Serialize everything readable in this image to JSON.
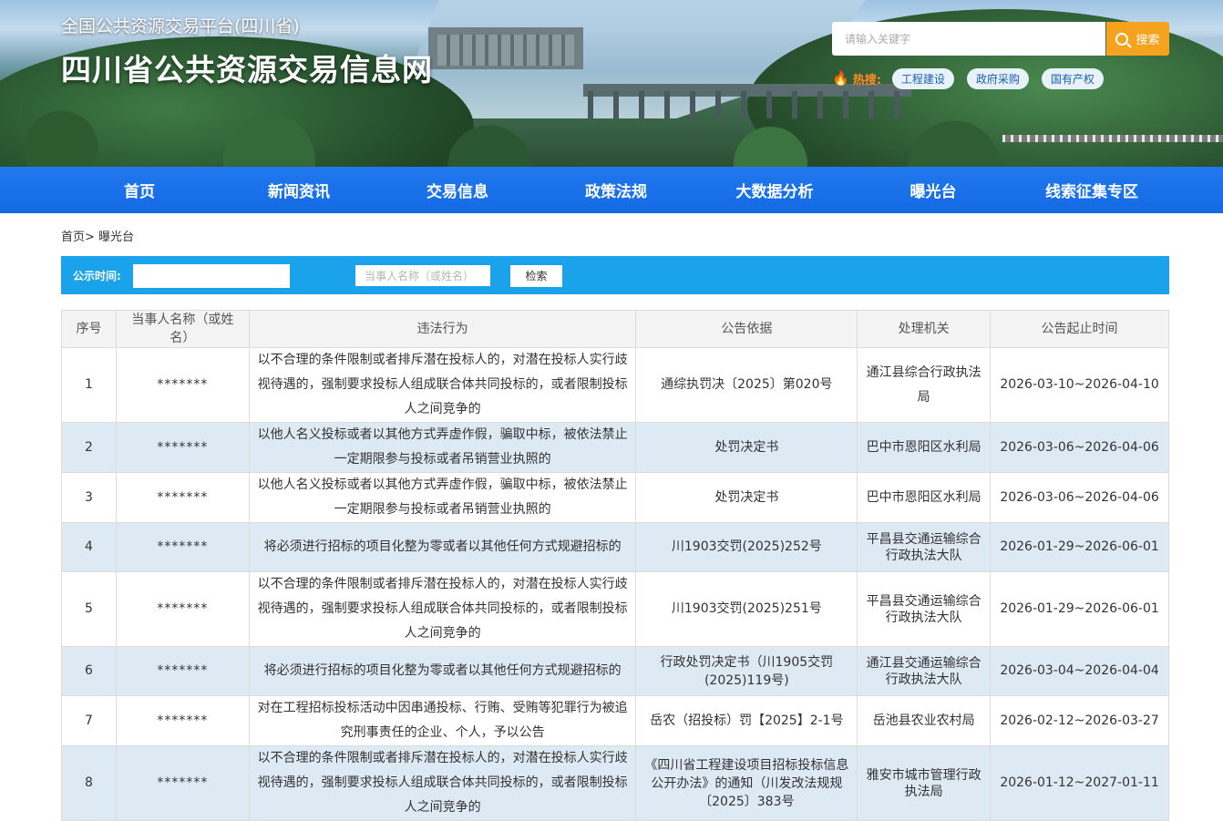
{
  "header": {
    "subtitle": "全国公共资源交易平台(四川省)",
    "title": "四川省公共资源交易信息网",
    "search_placeholder": "请输入关键字",
    "search_button": "搜索",
    "hot_label": "热搜:",
    "hot_tags": [
      "工程建设",
      "政府采购",
      "国有产权"
    ]
  },
  "nav": [
    "首页",
    "新闻资讯",
    "交易信息",
    "政策法规",
    "大数据分析",
    "曝光台",
    "线索征集专区"
  ],
  "breadcrumb": {
    "home": "首页>",
    "current": "曝光台"
  },
  "filter": {
    "date_label": "公示时间:",
    "date_value": "",
    "name_placeholder": "当事人名称（或姓名）",
    "search_button": "检索"
  },
  "table": {
    "headers": [
      "序号",
      "当事人名称（或姓名）",
      "违法行为",
      "公告依据",
      "处理机关",
      "公告起止时间"
    ],
    "rows": [
      [
        "1",
        "*******",
        "以不合理的条件限制或者排斥潜在投标人的，对潜在投标人实行歧视待遇的，强制要求投标人组成联合体共同投标的，或者限制投标人之间竞争的",
        "通综执罚决〔2025〕第020号",
        "通江县综合行政执法局",
        "2026-03-10~2026-04-10"
      ],
      [
        "2",
        "*******",
        "以他人名义投标或者以其他方式弄虚作假，骗取中标，被依法禁止一定期限参与投标或者吊销营业执照的",
        "处罚决定书",
        "巴中市恩阳区水利局",
        "2026-03-06~2026-04-06"
      ],
      [
        "3",
        "*******",
        "以他人名义投标或者以其他方式弄虚作假，骗取中标，被依法禁止一定期限参与投标或者吊销营业执照的",
        "处罚决定书",
        "巴中市恩阳区水利局",
        "2026-03-06~2026-04-06"
      ],
      [
        "4",
        "*******",
        "将必须进行招标的项目化整为零或者以其他任何方式规避招标的",
        "川1903交罚(2025)252号",
        "平昌县交通运输综合行政执法大队",
        "2026-01-29~2026-06-01"
      ],
      [
        "5",
        "*******",
        "以不合理的条件限制或者排斥潜在投标人的，对潜在投标人实行歧视待遇的，强制要求投标人组成联合体共同投标的，或者限制投标人之间竞争的",
        "川1903交罚(2025)251号",
        "平昌县交通运输综合行政执法大队",
        "2026-01-29~2026-06-01"
      ],
      [
        "6",
        "*******",
        "将必须进行招标的项目化整为零或者以其他任何方式规避招标的",
        "行政处罚决定书（川1905交罚(2025)119号)",
        "通江县交通运输综合行政执法大队",
        "2026-03-04~2026-04-04"
      ],
      [
        "7",
        "*******",
        "对在工程招标投标活动中因串通投标、行贿、受贿等犯罪行为被追究刑事责任的企业、个人，予以公告",
        "岳农（招投标）罚【2025】2-1号",
        "岳池县农业农村局",
        "2026-02-12~2026-03-27"
      ],
      [
        "8",
        "*******",
        "以不合理的条件限制或者排斥潜在投标人的，对潜在投标人实行歧视待遇的，强制要求投标人组成联合体共同投标的，或者限制投标人之间竞争的",
        "《四川省工程建设项目招标投标信息公开办法》的通知（川发改法规规〔2025〕383号",
        "雅安市城市管理行政执法局",
        "2026-01-12~2027-01-11"
      ]
    ]
  }
}
